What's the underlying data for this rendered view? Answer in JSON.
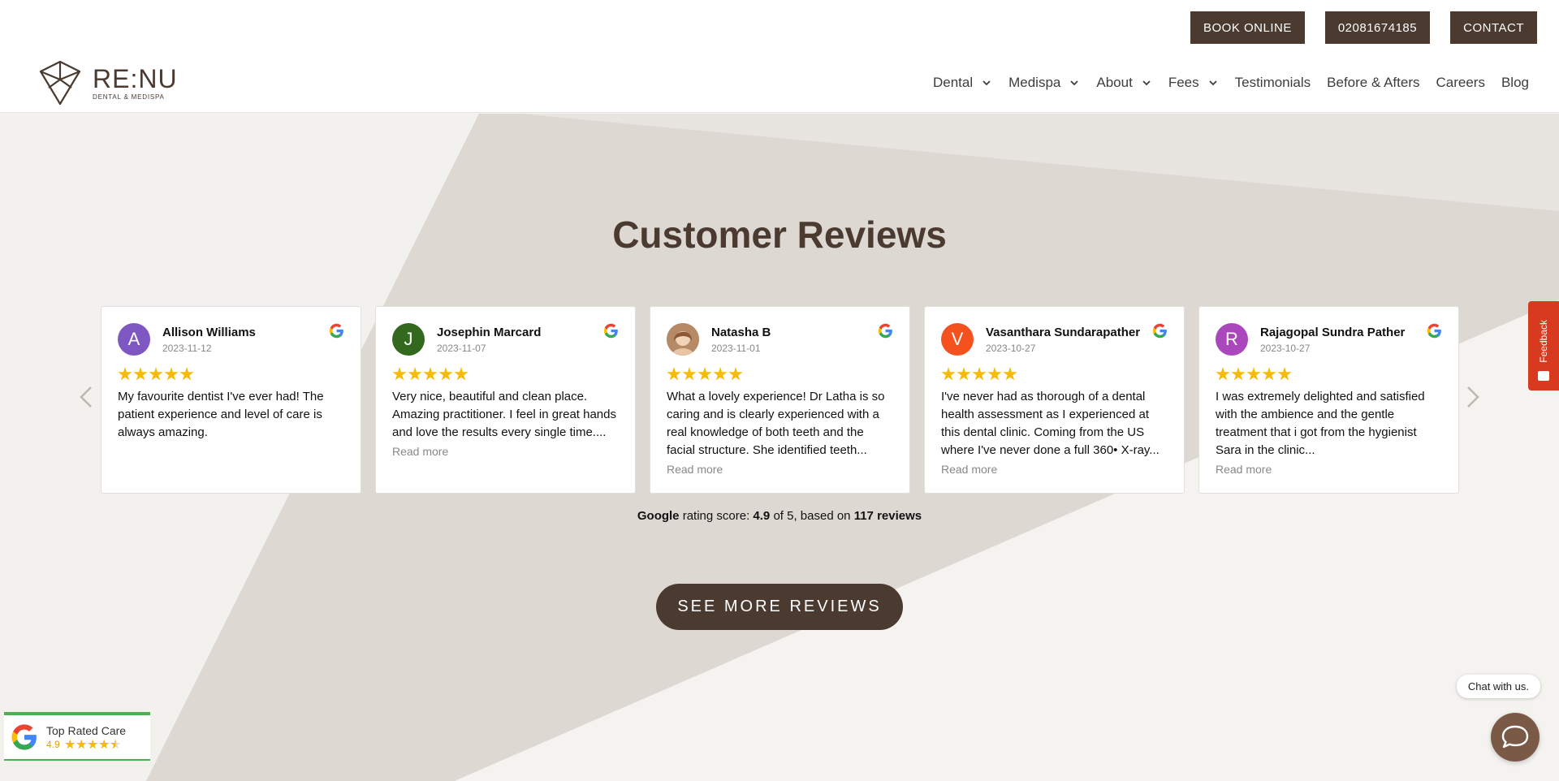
{
  "header": {
    "top_buttons": {
      "book": "BOOK ONLINE",
      "phone": "02081674185",
      "contact": "CONTACT"
    },
    "logo": {
      "name": "RE:NU",
      "tagline": "DENTAL & MEDISPA"
    },
    "nav": [
      "Dental",
      "Medispa",
      "About",
      "Fees",
      "Testimonials",
      "Before & Afters",
      "Careers",
      "Blog"
    ]
  },
  "reviews_section": {
    "title": "Customer Reviews",
    "reviews": [
      {
        "initial": "A",
        "name": "Allison Williams",
        "date": "2023-11-12",
        "text": "My favourite dentist I've ever had! The patient experience and level of care is always amazing.",
        "read_more": "",
        "avatar_color": "#7e57c2"
      },
      {
        "initial": "J",
        "name": "Josephin Marcard",
        "date": "2023-11-07",
        "text": "Very nice, beautiful and clean place. Amazing practitioner. I feel in great hands and love the results every single time....",
        "read_more": "Read more",
        "avatar_color": "#33691e"
      },
      {
        "initial": "",
        "name": "Natasha B",
        "date": "2023-11-01",
        "text": "What a lovely experience! Dr Latha is so caring and is clearly experienced with a real knowledge of both teeth and the facial structure. She identified teeth...",
        "read_more": "Read more",
        "avatar_color": "#c9a27e"
      },
      {
        "initial": "V",
        "name": "Vasanthara Sundarapather",
        "date": "2023-10-27",
        "text": "I've never had as thorough of a dental health assessment as I experienced at this dental clinic. Coming from the US where I've never done a full 360• X-ray...",
        "read_more": "Read more",
        "avatar_color": "#f4511e"
      },
      {
        "initial": "R",
        "name": "Rajagopal Sundra Pather",
        "date": "2023-10-27",
        "text": "I was extremely delighted and satisfied with the ambience and the gentle treatment that i got from the hygienist Sara in the clinic...",
        "read_more": "Read more",
        "avatar_color": "#ab47bc"
      }
    ],
    "rating": {
      "source": "Google",
      "label": "rating score:",
      "score": "4.9",
      "of": "of 5, based on",
      "count": "117 reviews"
    },
    "see_more": "SEE MORE REVIEWS"
  },
  "feedback_tab": "Feedback",
  "chat": {
    "label": "Chat with us."
  },
  "badge": {
    "title": "Top Rated Care",
    "score": "4.9",
    "star_rating": 4.5
  },
  "colors": {
    "brand": "#4a3a30",
    "star": "#f6bb06",
    "feedback": "#d83a1f",
    "badge_green": "#4caf50"
  }
}
